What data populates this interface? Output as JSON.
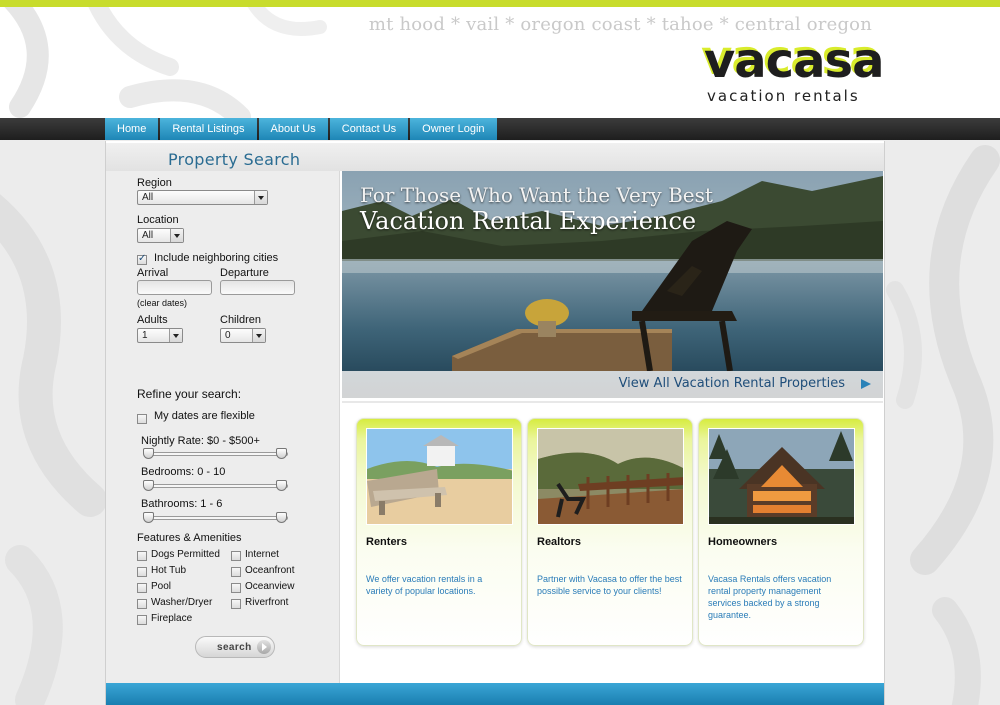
{
  "header": {
    "tagline": "mt hood * vail * oregon coast * tahoe * central oregon",
    "logo_word": "vacasa",
    "logo_sub": "vacation rentals"
  },
  "nav": {
    "items": [
      {
        "label": "Home"
      },
      {
        "label": "Rental Listings"
      },
      {
        "label": "About Us"
      },
      {
        "label": "Contact Us"
      },
      {
        "label": "Owner Login"
      }
    ]
  },
  "search": {
    "title": "Property Search",
    "region_label": "Region",
    "region_value": "All",
    "location_label": "Location",
    "location_value": "All",
    "neighboring_label": "Include neighboring cities",
    "neighboring_checked": true,
    "arrival_label": "Arrival",
    "departure_label": "Departure",
    "clear_dates": "(clear dates)",
    "adults_label": "Adults",
    "adults_value": "1",
    "children_label": "Children",
    "children_value": "0",
    "refine_label": "Refine your search:",
    "flexible_label": "My dates are flexible",
    "flexible_checked": false,
    "nightly_rate_label": "Nightly Rate: $0 - $500+",
    "nightly_rate_range": [
      0,
      500
    ],
    "bedrooms_label": "Bedrooms: 0 - 10",
    "bedrooms_range": [
      0,
      10
    ],
    "bathrooms_label": "Bathrooms: 1 - 6",
    "bathrooms_range": [
      1,
      6
    ],
    "features_label": "Features & Amenities",
    "features_left": [
      "Dogs Permitted",
      "Hot Tub",
      "Pool",
      "Washer/Dryer",
      "Fireplace"
    ],
    "features_right": [
      "Internet",
      "Oceanfront",
      "Oceanview",
      "Riverfront"
    ],
    "search_button": "search"
  },
  "hero": {
    "line1": "For Those Who Want the Very Best",
    "line2": "Vacation Rental Experience",
    "link": "View All Vacation Rental Properties"
  },
  "cards": [
    {
      "title": "Renters",
      "text": "We offer vacation rentals in a variety of popular locations."
    },
    {
      "title": "Realtors",
      "text": "Partner with Vacasa to offer the best possible service to your clients!"
    },
    {
      "title": "Homeowners",
      "text": "Vacasa Rentals offers vacation rental property management services backed by a strong guarantee."
    }
  ],
  "colors": {
    "accent_green": "#c8dc2c",
    "nav_blue": "#2a95c6",
    "link_blue": "#1f4e7a",
    "card_text_blue": "#2a7cb8"
  }
}
